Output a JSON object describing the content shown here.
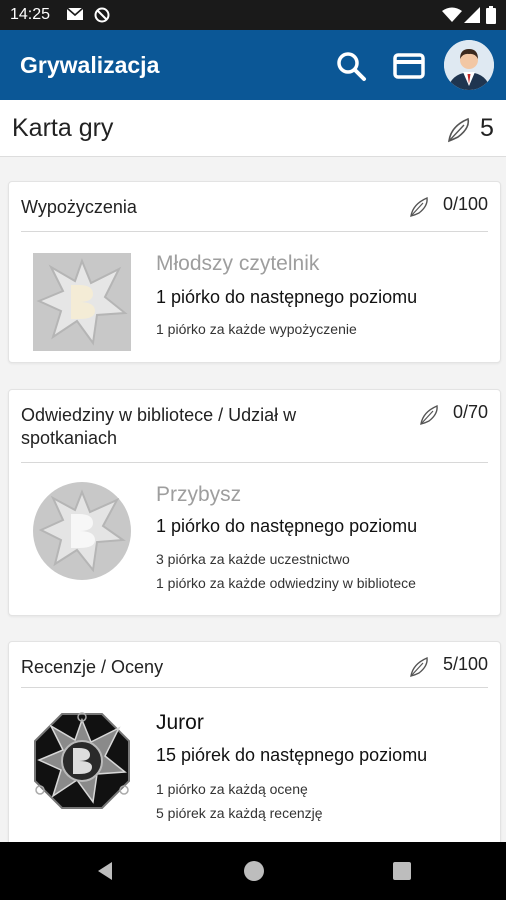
{
  "status_bar": {
    "time": "14:25"
  },
  "app_bar": {
    "title": "Grywalizacja"
  },
  "page_header": {
    "title": "Karta gry",
    "feathers": "5"
  },
  "cards": [
    {
      "category": "Wypożyczenia",
      "progress": "0/100",
      "level": "Młodszy czytelnik",
      "next_level": "1 piórko do następnego poziomu",
      "rules": [
        "1 piórko za każde wypożyczenie"
      ]
    },
    {
      "category": "Odwiedziny w bibliotece / Udział w spotkaniach",
      "progress": "0/70",
      "level": "Przybysz",
      "next_level": "1 piórko do następnego poziomu",
      "rules": [
        "3 piórka za każde uczestnictwo",
        "1 piórko za każde odwiedziny w bibliotece"
      ]
    },
    {
      "category": "Recenzje / Oceny",
      "progress": "5/100",
      "level": "Juror",
      "next_level": "15 piórek do następnego poziomu",
      "rules": [
        "1 piórko za każdą ocenę",
        "5 piórek za każdą recenzję"
      ]
    }
  ],
  "colors": {
    "app_bar": "#0b5796",
    "locked_level": "#9e9e9e",
    "active_level": "#111111"
  },
  "icons": [
    "mail-icon",
    "dnd-icon",
    "wifi-icon",
    "signal-icon",
    "battery-icon",
    "search-icon",
    "card-icon",
    "avatar",
    "feather-icon",
    "back-icon",
    "home-icon",
    "recents-icon"
  ]
}
